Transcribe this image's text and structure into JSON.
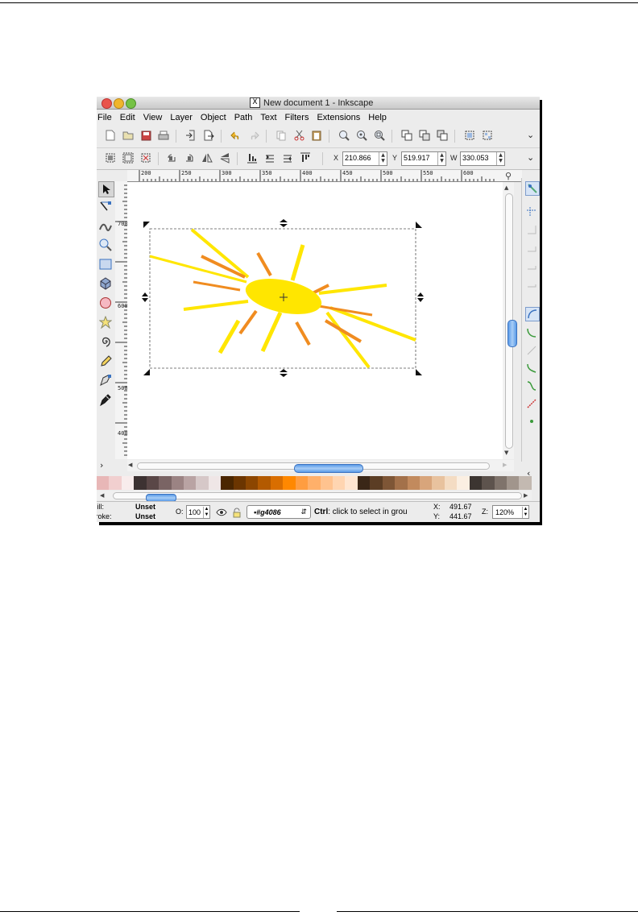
{
  "window": {
    "title": "New document 1 - Inkscape"
  },
  "menu": [
    "File",
    "Edit",
    "View",
    "Layer",
    "Object",
    "Path",
    "Text",
    "Filters",
    "Extensions",
    "Help"
  ],
  "toolbar": {
    "x_label": "X",
    "x_value": "210.866",
    "y_label": "Y",
    "y_value": "519.917",
    "w_label": "W",
    "w_value": "330.053"
  },
  "ruler": {
    "h_ticks": [
      "200",
      "250",
      "300",
      "350",
      "400",
      "450",
      "500",
      "550",
      "600"
    ],
    "v_ticks": [
      "700",
      "600",
      "500",
      "400"
    ]
  },
  "palette": [
    "#e8b7b7",
    "#f1cfcf",
    "#f8ecec",
    "#3d3232",
    "#5a4747",
    "#7a6464",
    "#9b8383",
    "#b9a3a3",
    "#d6c8c8",
    "#efe6e6",
    "#4a2600",
    "#6b3500",
    "#8c4600",
    "#b35a00",
    "#d96e00",
    "#ff8800",
    "#ff9d40",
    "#ffb06a",
    "#ffc38f",
    "#ffd5b1",
    "#ffe6d1",
    "#3a2717",
    "#5b3d24",
    "#7e5636",
    "#a3714a",
    "#c28a5d",
    "#d8a57b",
    "#e8c29e",
    "#f4dcc3",
    "#fbefe2",
    "#3c3531",
    "#5d534d",
    "#7f736b",
    "#a1958c",
    "#c3b9b1"
  ],
  "status": {
    "fill_label": "Fill:",
    "fill_value": "Unset",
    "stroke_label": "Stroke:",
    "stroke_value": "Unset",
    "opacity_label": "O:",
    "opacity_value": "100",
    "layer_value": "•#g4086",
    "hint_key": "Ctrl",
    "hint_text": ": click to select in grou",
    "x_label": "X:",
    "x_value": "491.67",
    "y_label": "Y:",
    "y_value": "441.67",
    "zoom_label": "Z:",
    "zoom_value": "120%"
  },
  "colors": {
    "sun_yellow": "#ffe600",
    "ray_orange": "#f08c20",
    "ray_yellow": "#ffe600"
  }
}
